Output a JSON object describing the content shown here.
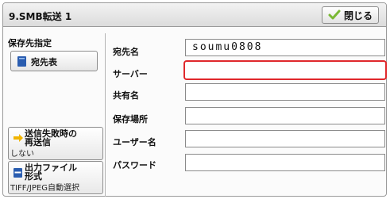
{
  "window": {
    "title": "9.SMB転送 1",
    "close_label": "閉じる"
  },
  "left": {
    "section_label": "保存先指定",
    "address_book_label": "宛先表",
    "retry": {
      "label_line1": "送信失敗時の",
      "label_line2": "再送信",
      "value": "しない"
    },
    "file_format": {
      "label_line1": "出力ファイル",
      "label_line2": "形式",
      "value": "TIFF/JPEG自動選択"
    }
  },
  "form": {
    "destination_label": "宛先名",
    "destination_value": "soumu0808",
    "server_label": "サーバー",
    "server_value": "",
    "share_label": "共有名",
    "share_value": "",
    "location_label": "保存場所",
    "location_value": "",
    "user_label": "ユーザー名",
    "user_value": "",
    "password_label": "パスワード",
    "password_value": ""
  },
  "colors": {
    "selection": "#e0282c",
    "check": "#7ab834",
    "icon_blue": "#2a5db0",
    "arrow_yellow": "#f0b400"
  }
}
